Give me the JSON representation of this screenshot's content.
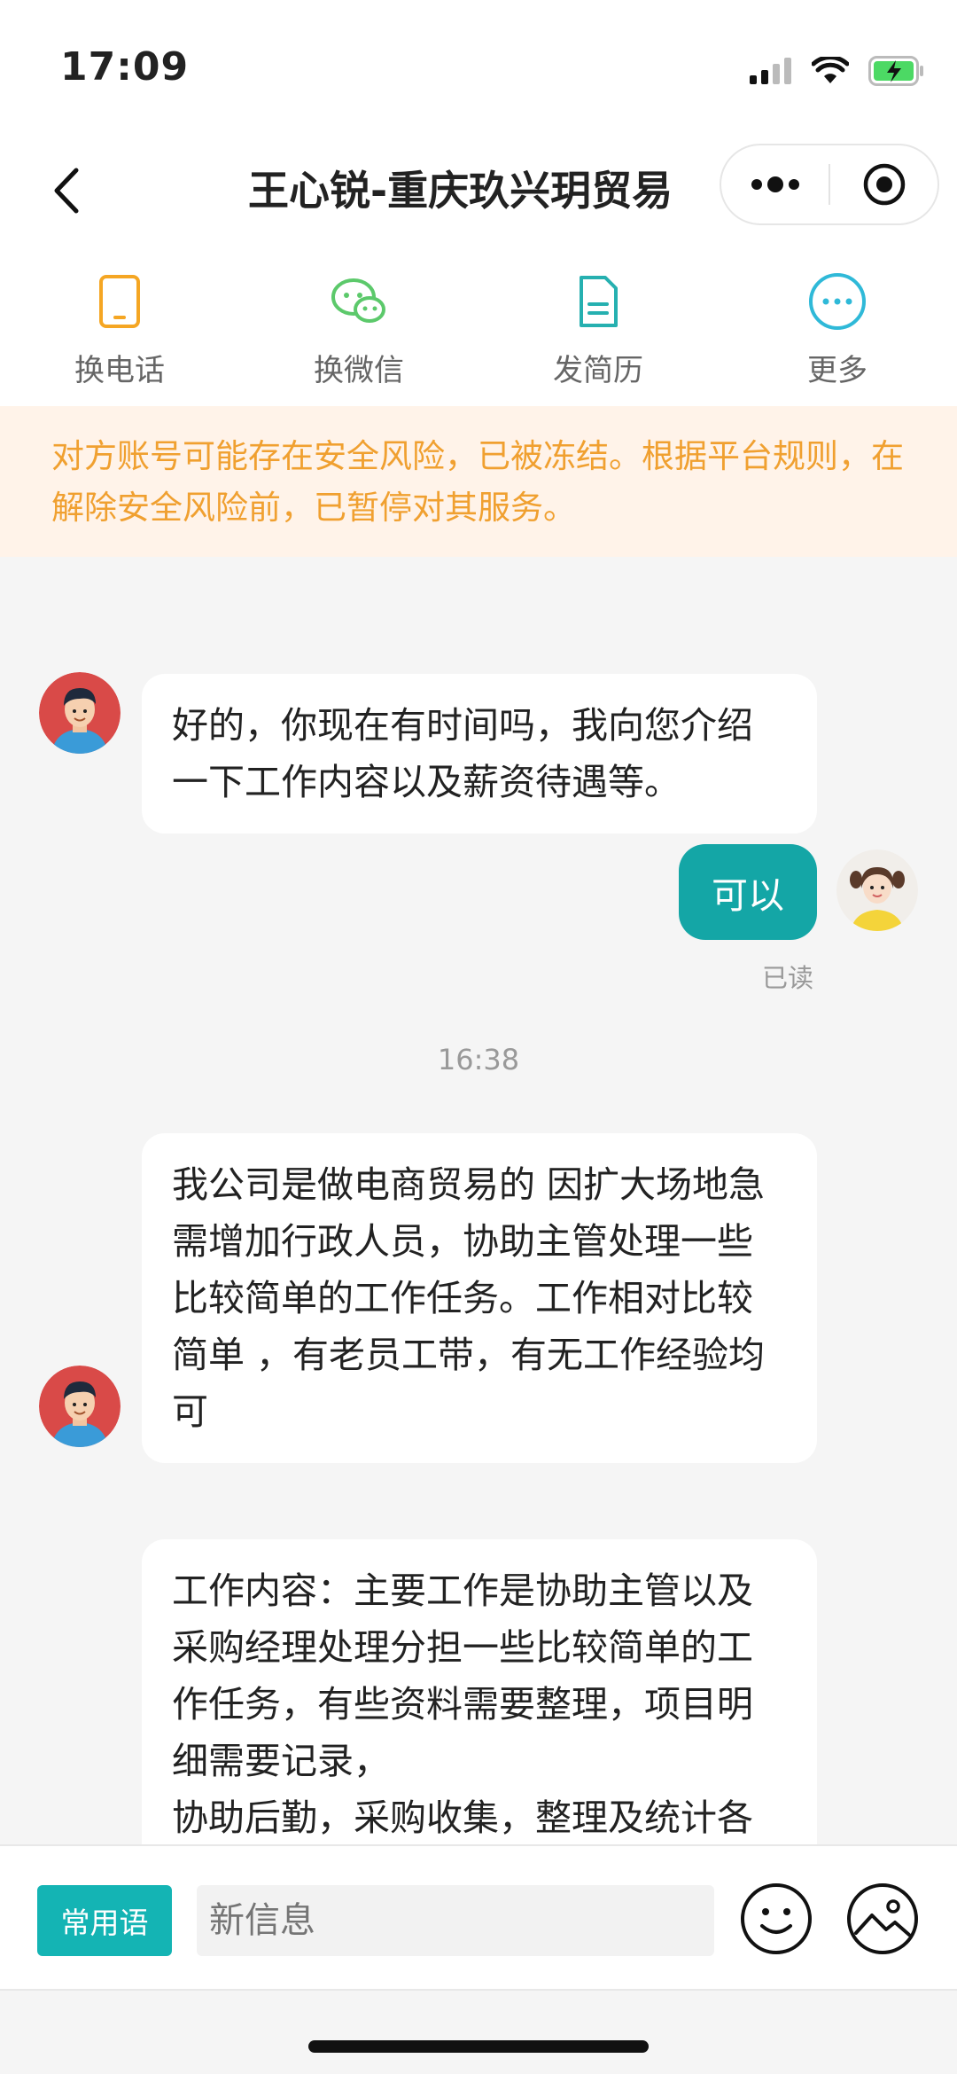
{
  "status_bar": {
    "time": "17:09"
  },
  "nav": {
    "title": "王心锐-重庆玖兴玥贸易"
  },
  "actions": [
    {
      "label": "换电话",
      "icon": "phone-icon",
      "color": "#f5a623"
    },
    {
      "label": "换微信",
      "icon": "wechat-icon",
      "color": "#5cc96b"
    },
    {
      "label": "发简历",
      "icon": "resume-icon",
      "color": "#26b0b0"
    },
    {
      "label": "更多",
      "icon": "more-icon",
      "color": "#2fb9d8"
    }
  ],
  "warning": {
    "text": "对方账号可能存在安全风险，已被冻结。根据平台规则，在解除安全风险前，已暂停对其服务。"
  },
  "messages": [
    {
      "side": "left",
      "text": "好的，你现在有时间吗，我向您介绍一下工作内容以及薪资待遇等。"
    },
    {
      "side": "right",
      "text": "可以",
      "status": "已读"
    },
    {
      "time": "16:38"
    },
    {
      "side": "left",
      "text": "我公司是做电商贸易的 因扩大场地急需增加行政人员，协助主管处理一些比较简单的工作任务。工作相对比较简单 ，有老员工带，有无工作经验均可"
    },
    {
      "side": "left",
      "text": "工作内容：主要工作是协助主管以及采购经理处理分担一些比较简单的工作任务，有些资料需要整理，项目明细需要记录，\n协助后勤，采购收集，整理及统计各"
    }
  ],
  "input_bar": {
    "phrase_label": "常用语",
    "placeholder": "新信息"
  },
  "colors": {
    "accent": "#14a6a6",
    "warning_text": "#f0a030",
    "warning_bg": "#fff3e9",
    "battery": "#4cd964"
  }
}
